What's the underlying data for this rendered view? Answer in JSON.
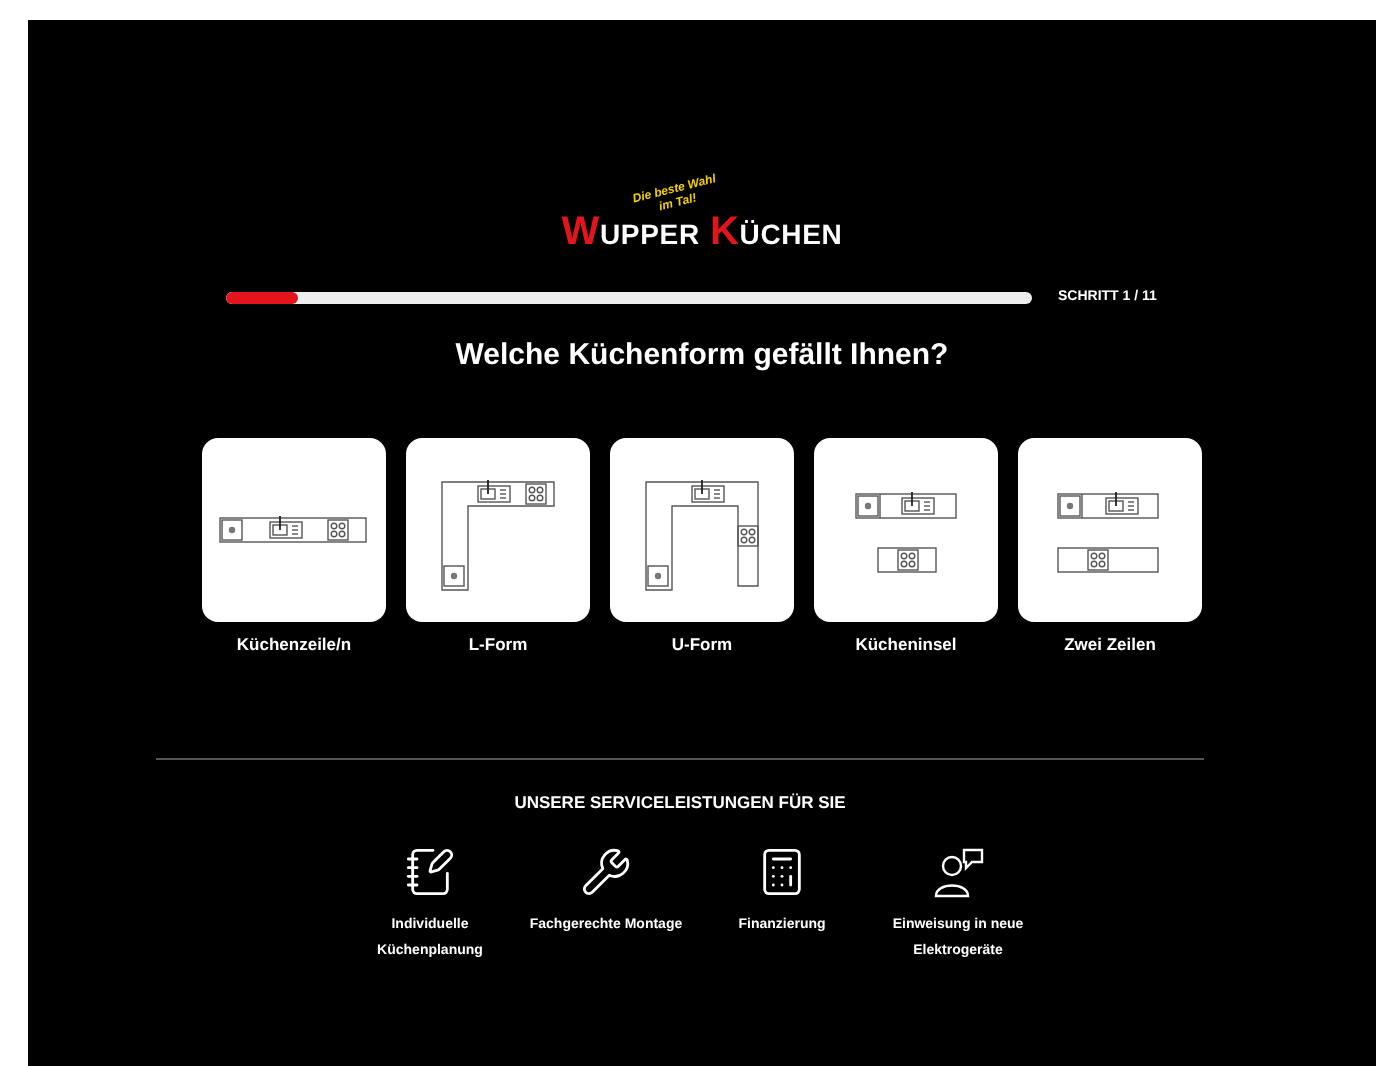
{
  "logo": {
    "tagline_1": "Die beste Wahl",
    "tagline_2": "im Tal!",
    "words": [
      {
        "initial": "W",
        "rest": "UPPER"
      },
      {
        "initial": "K",
        "rest": "ÜCHEN"
      }
    ]
  },
  "progress": {
    "level": 0.09,
    "label": "SCHRITT 1 / 11"
  },
  "question": "Welche Küchenform gefällt Ihnen?",
  "options": [
    {
      "kind": "row",
      "label": "Küchenzeile/n"
    },
    {
      "kind": "l",
      "label": "L-Form"
    },
    {
      "kind": "u",
      "label": "U-Form"
    },
    {
      "kind": "island",
      "label": "Kücheninsel"
    },
    {
      "kind": "tworows",
      "label": "Zwei Zeilen"
    }
  ],
  "services": {
    "title": "UNSERE SERVICELEISTUNGEN FÜR SIE",
    "items": [
      {
        "kind": "planning",
        "lines": [
          "Individuelle",
          "Küchenplanung"
        ]
      },
      {
        "kind": "assembly",
        "lines": [
          "Fachgerechte Montage"
        ]
      },
      {
        "kind": "finance",
        "lines": [
          "Finanzierung"
        ]
      },
      {
        "kind": "instruction",
        "lines": [
          "Einweisung in neue",
          "Elektrogeräte"
        ]
      }
    ]
  }
}
